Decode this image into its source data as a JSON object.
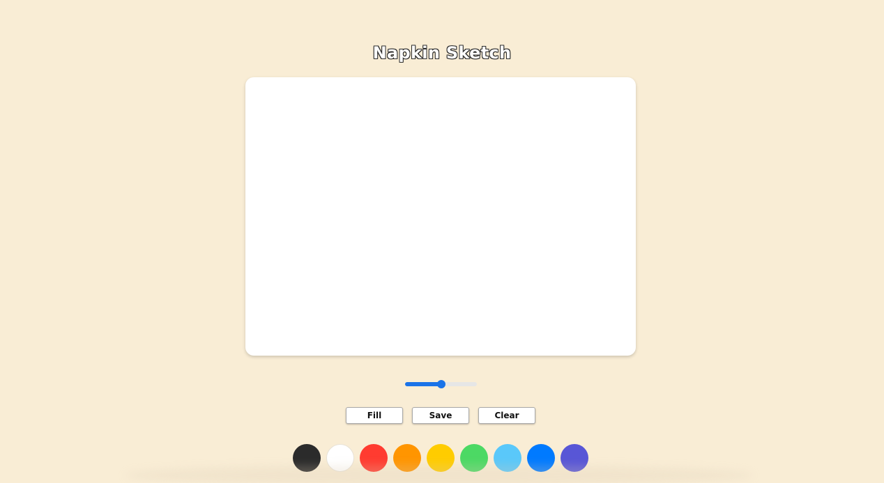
{
  "app": {
    "title": "Napkin Sketch"
  },
  "brush": {
    "size_fraction": 0.5,
    "accent_color": "#1a73e8"
  },
  "actions": {
    "fill_label": "Fill",
    "save_label": "Save",
    "clear_label": "Clear"
  },
  "palette": {
    "colors": [
      {
        "name": "black",
        "hex": "#2b2b2b"
      },
      {
        "name": "white",
        "hex": "#ffffff"
      },
      {
        "name": "red",
        "hex": "#ff3b30"
      },
      {
        "name": "orange",
        "hex": "#ff9500"
      },
      {
        "name": "yellow",
        "hex": "#ffcc00"
      },
      {
        "name": "green",
        "hex": "#4cd964"
      },
      {
        "name": "light-blue",
        "hex": "#5ac8fa"
      },
      {
        "name": "blue",
        "hex": "#007aff"
      },
      {
        "name": "purple",
        "hex": "#5856d6"
      }
    ]
  },
  "theme": {
    "background": "#f9edd5",
    "canvas": "#ffffff"
  }
}
